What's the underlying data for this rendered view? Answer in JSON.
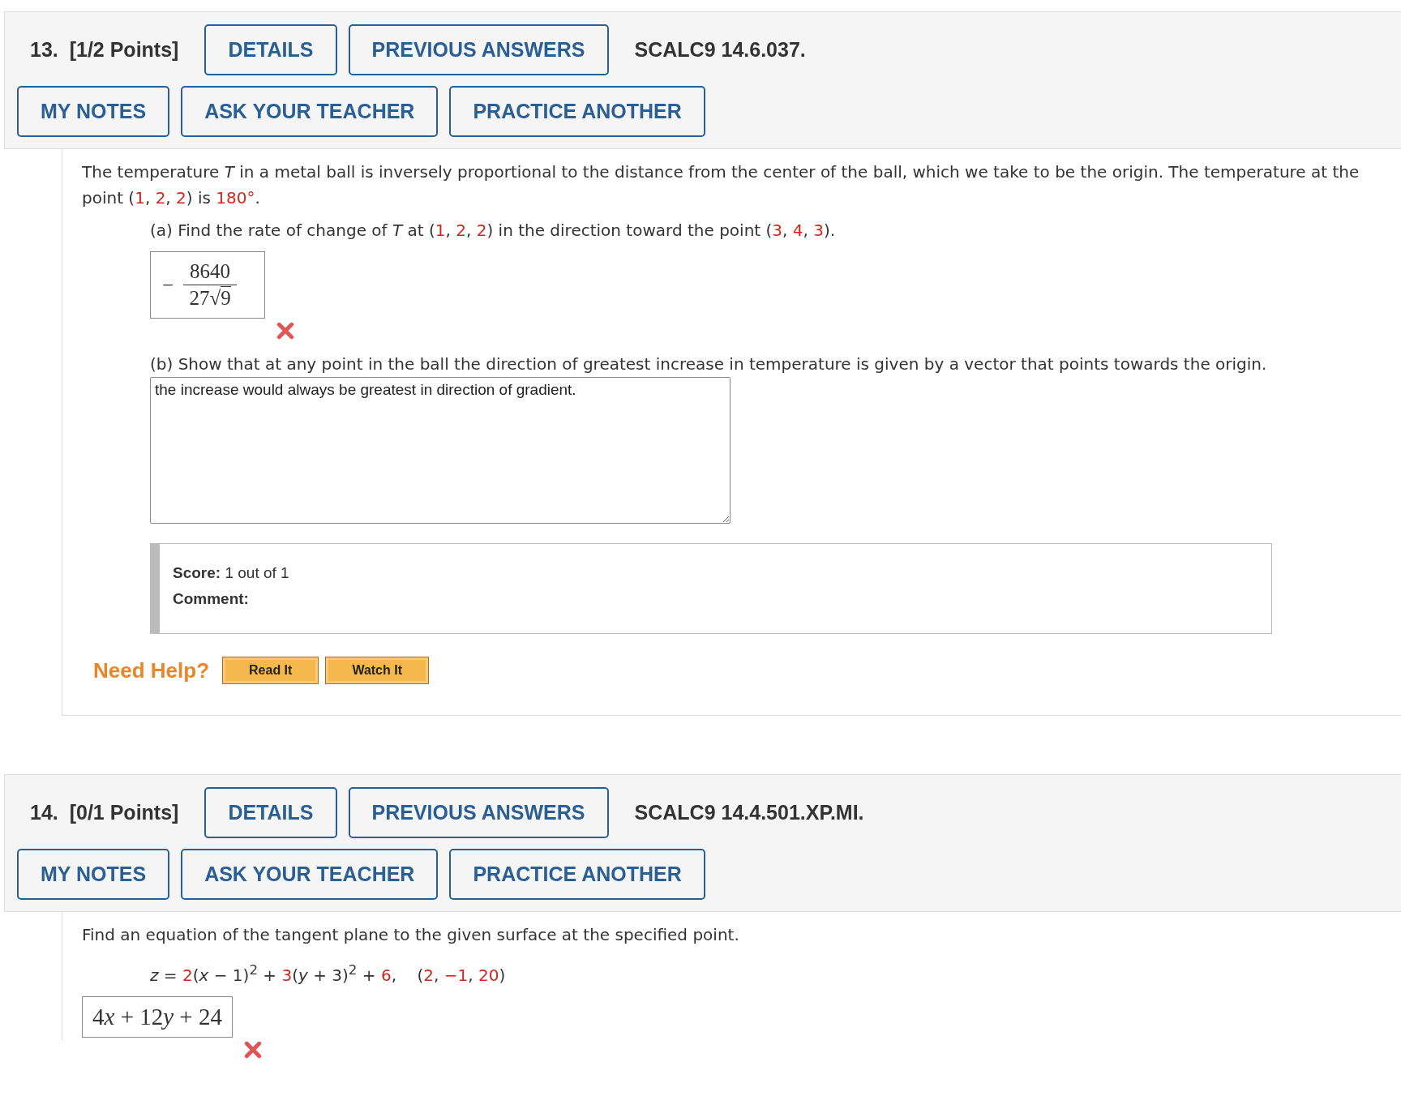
{
  "questions": [
    {
      "number": "13.",
      "points": "[1/2 Points]",
      "top_buttons": [
        "DETAILS",
        "PREVIOUS ANSWERS"
      ],
      "code": "SCALC9 14.6.037.",
      "bottom_buttons": [
        "MY NOTES",
        "ASK YOUR TEACHER",
        "PRACTICE ANOTHER"
      ],
      "prompt": [
        {
          "text": "The temperature *T* in a metal ball is inversely proportional to the distance from the center of the ball, which we take to be the origin. The temperature at the point (",
          "given": false
        },
        {
          "text": "1",
          "given": true
        },
        {
          "text": ", ",
          "given": false
        },
        {
          "text": "2",
          "given": true
        },
        {
          "text": ", ",
          "given": false
        },
        {
          "text": "2",
          "given": true
        },
        {
          "text": ") is ",
          "given": false
        },
        {
          "text": "180°",
          "given": true
        },
        {
          "text": ".",
          "given": false
        }
      ],
      "parts": [
        {
          "kind": "fraction",
          "prompt": [
            {
              "text": "(a) Find the rate of change of *T* at (",
              "given": false
            },
            {
              "text": "1",
              "given": true
            },
            {
              "text": ", ",
              "given": false
            },
            {
              "text": "2",
              "given": true
            },
            {
              "text": ", ",
              "given": false
            },
            {
              "text": "2",
              "given": true
            },
            {
              "text": ") in the direction toward the point (",
              "given": false
            },
            {
              "text": "3",
              "given": true
            },
            {
              "text": ", ",
              "given": false
            },
            {
              "text": "4",
              "given": true
            },
            {
              "text": ", ",
              "given": false
            },
            {
              "text": "3",
              "given": true
            },
            {
              "text": ").",
              "given": false
            }
          ],
          "answer": {
            "sign": "−",
            "numerator": "8640",
            "coefficient": "27",
            "radical": "√",
            "radicand": "9"
          },
          "correct": false
        },
        {
          "kind": "essay",
          "prompt": [
            {
              "text": "(b) Show that at any point in the ball the direction of greatest increase in temperature is given by a vector that points towards the origin.",
              "given": false
            }
          ],
          "response": "the increase would always be greatest in direction of gradient.",
          "score": {
            "label": "Score:",
            "value": "1 out of 1",
            "comment_label": "Comment:"
          }
        }
      ],
      "help": {
        "label": "Need Help?",
        "buttons": [
          "Read It",
          "Watch It"
        ]
      }
    },
    {
      "number": "14.",
      "points": "[0/1 Points]",
      "top_buttons": [
        "DETAILS",
        "PREVIOUS ANSWERS"
      ],
      "code": "SCALC9 14.4.501.XP.MI.",
      "bottom_buttons": [
        "MY NOTES",
        "ASK YOUR TEACHER",
        "PRACTICE ANOTHER"
      ],
      "prompt": [
        {
          "text": "Find an equation of the tangent plane to the given surface at the specified point.",
          "given": false
        }
      ],
      "parts": [
        {
          "kind": "equation",
          "prompt": [
            {
              "text": "*z* = ",
              "given": false
            },
            {
              "text": "2",
              "given": true
            },
            {
              "text": "(*x* − 1)$^{2}$ + ",
              "given": false
            },
            {
              "text": "3",
              "given": true
            },
            {
              "text": "(*y* + 3)$^{2}$ + ",
              "given": false
            },
            {
              "text": "6",
              "given": true
            },
            {
              "text": ",    (",
              "given": false
            },
            {
              "text": "2",
              "given": true
            },
            {
              "text": ", ",
              "given": false
            },
            {
              "text": "−1",
              "given": true
            },
            {
              "text": ", ",
              "given": false
            },
            {
              "text": "20",
              "given": true
            },
            {
              "text": ")",
              "given": false
            }
          ]
        },
        {
          "kind": "expression",
          "answer": [
            "4",
            "*x*",
            " + 12",
            "*y*",
            " + 24"
          ],
          "correct": false
        }
      ]
    }
  ]
}
